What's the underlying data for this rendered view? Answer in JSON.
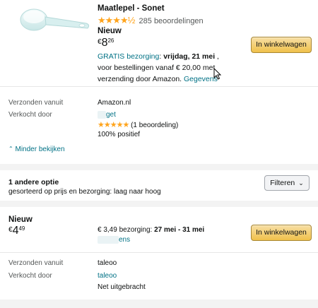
{
  "product": {
    "title": "Maatlepel - Sonet",
    "stars": "★★★★½",
    "rating_count": "285 beoordelingen",
    "condition": "Nieuw",
    "price": {
      "symbol": "€",
      "whole": "8",
      "fraction": "26"
    },
    "delivery": {
      "free_label": "GRATIS bezorging",
      "separator": ":",
      "date": "vrijdag, 21 mei",
      "line1_tail": " ,",
      "line2": "voor bestellingen vanaf € 20,00 met",
      "line3": "verzending door Amazon.",
      "details_link": "Gegevens"
    },
    "add_to_cart": "In winkelwagen"
  },
  "seller_info": {
    "shipped_from_label": "Verzonden vanuit",
    "shipped_from_value": "Amazon.nl",
    "sold_by_label": "Verkocht door",
    "sold_by_value": "get",
    "seller_stars": "★★★★★",
    "seller_rating": "(1 beoordeling)",
    "positive": "100% positief"
  },
  "show_less": "Minder bekijken",
  "other_options": {
    "title": "1 andere optie",
    "subtitle": "gesorteerd op prijs en bezorging: laag naar hoog",
    "filter_label": "Filteren"
  },
  "offer": {
    "condition": "Nieuw",
    "price": {
      "symbol": "€",
      "whole": "4",
      "fraction": "49"
    },
    "shipping_price": "€ 3,49 bezorging:",
    "shipping_dates": "27 mei - 31 mei",
    "seller_link": "ens",
    "add_to_cart": "In winkelwagen",
    "shipped_from_label": "Verzonden vanuit",
    "shipped_from_value": "taleoo",
    "sold_by_label": "Verkocht door",
    "sold_by_value": "taleoo",
    "seller_note": "Net uitgebracht"
  },
  "colors": {
    "link": "#007185",
    "star": "#ffa41c",
    "button": "#f0c14b",
    "band": "#f3f3f3"
  }
}
